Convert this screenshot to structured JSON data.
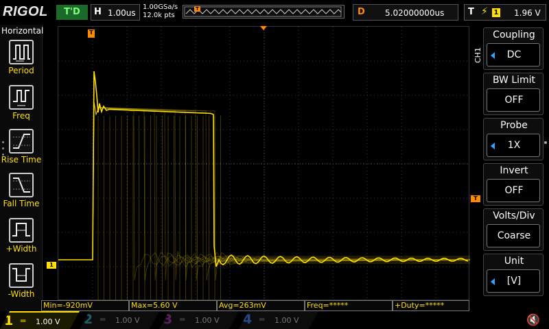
{
  "top": {
    "logo": "RIGOL",
    "trig_status": "T'D",
    "horizontal": {
      "key": "H",
      "value": "1.00us"
    },
    "sample_rate": "1.00GSa/s",
    "memory_depth": "12.0k pts",
    "memory_marker": "T",
    "delay": {
      "key": "D",
      "value": "5.02000000us"
    },
    "trigger": {
      "key": "T",
      "edge_icon": "rising-edge-icon",
      "source": "1",
      "level": "1.96 V"
    }
  },
  "left_menu": {
    "title": "Horizontal",
    "items": [
      {
        "label": "Period",
        "icon": "period-icon"
      },
      {
        "label": "Freq",
        "icon": "frequency-icon"
      },
      {
        "label": "Rise Time",
        "icon": "rise-time-icon"
      },
      {
        "label": "Fall Time",
        "icon": "fall-time-icon"
      },
      {
        "label": "+Width",
        "icon": "positive-width-icon"
      },
      {
        "label": "-Width",
        "icon": "negative-width-icon"
      }
    ]
  },
  "screen": {
    "trigger_marker": "T",
    "trigger_level_marker": "T",
    "ch1_marker": "1",
    "trace_color": "#ffe000"
  },
  "right_menu": {
    "channel_label": "CH1",
    "items": [
      {
        "title": "Coupling",
        "value": "DC",
        "has_arrow": true
      },
      {
        "title": "BW Limit",
        "value": "OFF",
        "has_arrow": false
      },
      {
        "title": "Probe",
        "value": "1X",
        "has_arrow": true
      },
      {
        "title": "Invert",
        "value": "OFF",
        "has_arrow": false
      },
      {
        "title": "Volts/Div",
        "value": "Coarse",
        "has_arrow": false
      },
      {
        "title": "Unit",
        "value": "[V]",
        "has_arrow": true
      }
    ]
  },
  "measurements": [
    "Min=-920mV",
    "Max=5.60 V",
    "Avg=263mV",
    "Freq=*****",
    "+Duty=*****"
  ],
  "channels": [
    {
      "num": "1",
      "value": "1.00 V",
      "color": "#ffe000",
      "active": true
    },
    {
      "num": "2",
      "value": "1.00 V",
      "color": "#19d9e6",
      "active": false
    },
    {
      "num": "3",
      "value": "1.00 V",
      "color": "#e030e0",
      "active": false
    },
    {
      "num": "4",
      "value": "1.00 V",
      "color": "#2a6cff",
      "active": false
    }
  ],
  "colors": {
    "accent_orange": "#ff8a00",
    "ch1_yellow": "#ffe000",
    "menu_blue": "#2aa7ff"
  }
}
